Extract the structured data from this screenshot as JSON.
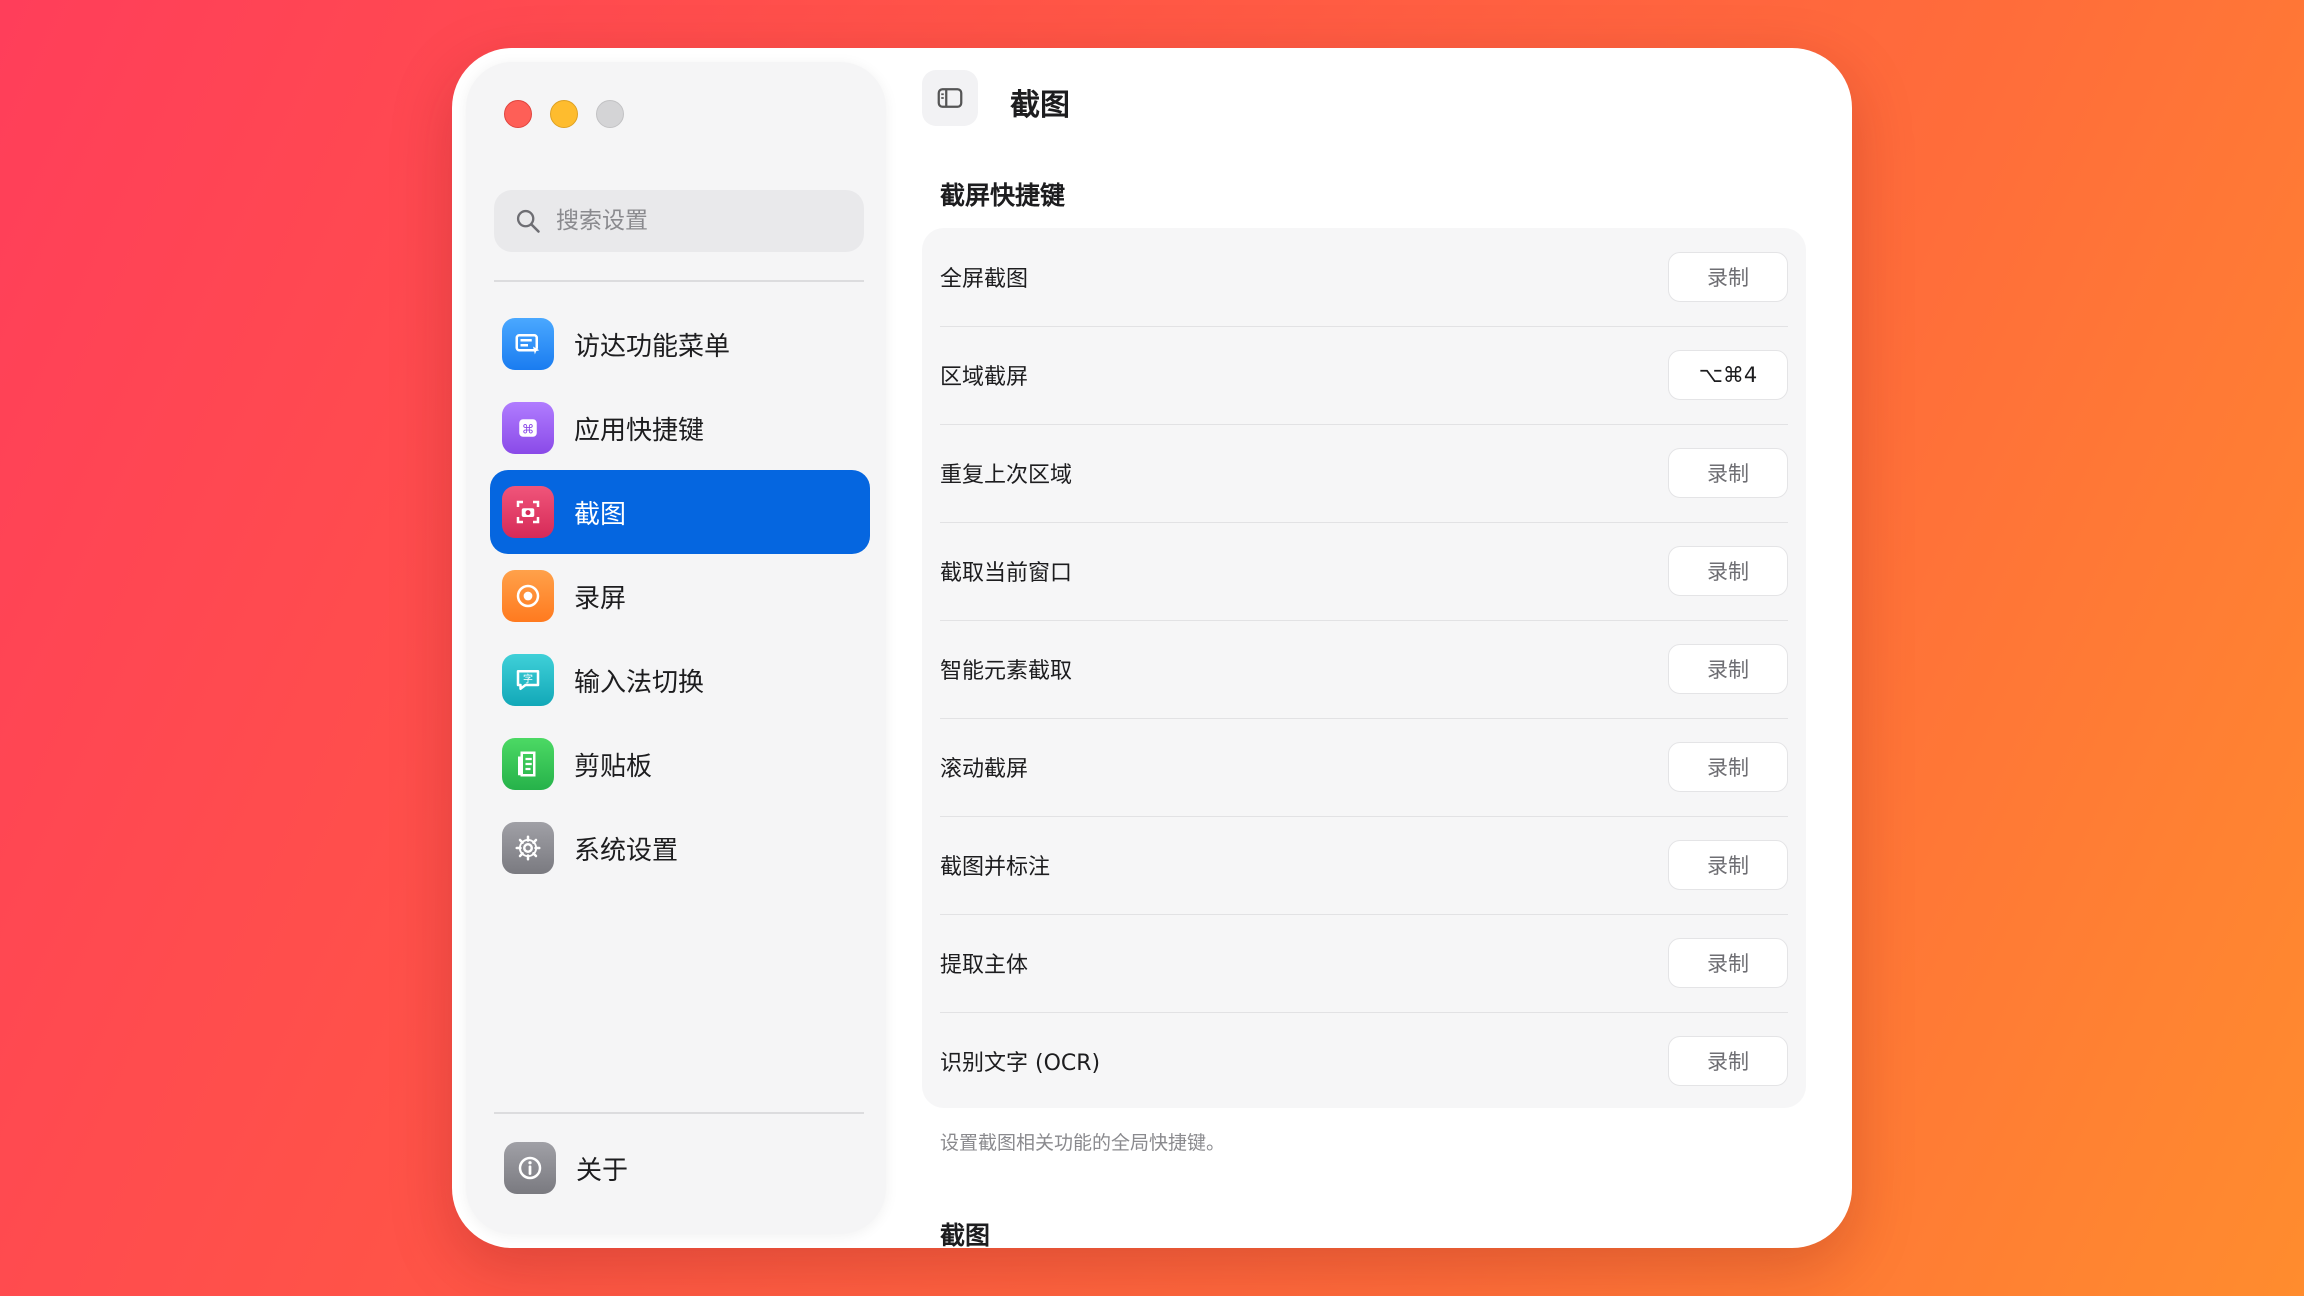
{
  "sidebar": {
    "search_placeholder": "搜索设置",
    "items": [
      {
        "label": "访达功能菜单",
        "icon": "finder-menu-icon",
        "color": "#2f8ff5"
      },
      {
        "label": "应用快捷键",
        "icon": "command-key-icon",
        "color": "#9b5cf0"
      },
      {
        "label": "截图",
        "icon": "screenshot-icon",
        "color": "#e63a64",
        "active": true
      },
      {
        "label": "录屏",
        "icon": "record-icon",
        "color": "#ff8a2a"
      },
      {
        "label": "输入法切换",
        "icon": "input-method-icon",
        "color": "#1fb7c4"
      },
      {
        "label": "剪贴板",
        "icon": "clipboard-icon",
        "color": "#34c759"
      },
      {
        "label": "系统设置",
        "icon": "gear-icon",
        "color": "#8e8e93"
      }
    ],
    "about": {
      "label": "关于",
      "icon": "info-icon",
      "color": "#8e8e93"
    }
  },
  "main": {
    "title": "截图",
    "section1_title": "截屏快捷键",
    "rows": [
      {
        "label": "全屏截图",
        "button": "录制"
      },
      {
        "label": "区域截屏",
        "button": "⌥⌘4"
      },
      {
        "label": "重复上次区域",
        "button": "录制"
      },
      {
        "label": "截取当前窗口",
        "button": "录制"
      },
      {
        "label": "智能元素截取",
        "button": "录制"
      },
      {
        "label": "滚动截屏",
        "button": "录制"
      },
      {
        "label": "截图并标注",
        "button": "录制"
      },
      {
        "label": "提取主体",
        "button": "录制"
      },
      {
        "label": "识别文字 (OCR)",
        "button": "录制"
      }
    ],
    "footnote": "设置截图相关功能的全局快捷键。",
    "section2_title": "截图"
  }
}
